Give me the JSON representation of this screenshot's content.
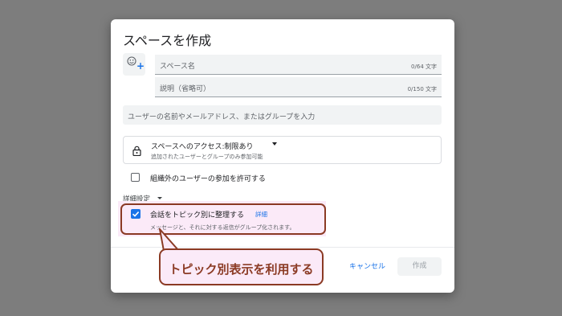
{
  "dialog": {
    "title": "スペースを作成",
    "emoji_icon": "emoji-add-icon",
    "name_field": {
      "placeholder": "スペース名",
      "counter": "0/64 文字"
    },
    "description_field": {
      "placeholder": "説明（省略可）",
      "counter": "0/150 文字"
    },
    "people_field": {
      "placeholder": "ユーザーの名前やメールアドレス、またはグループを入力"
    },
    "access": {
      "icon": "lock-icon",
      "title": "スペースへのアクセス:制限あり",
      "subtitle": "追加されたユーザーとグループのみ参加可能"
    },
    "external_checkbox": {
      "label": "組織外のユーザーの参加を許可する",
      "checked": false
    },
    "advanced": {
      "label": "詳細設定"
    },
    "topic_checkbox": {
      "label": "会話をトピック別に整理する",
      "link": "詳細",
      "subtitle": "メッセージと、それに対する返信がグループ化されます。",
      "checked": true
    },
    "cancel_label": "キャンセル",
    "create_label": "作成"
  },
  "annotation": {
    "callout_text": "トピック別表示を利用する",
    "color": "#8b3a24",
    "fill": "#fbeaf8"
  },
  "colors": {
    "backdrop": "#7d7d7d",
    "accent": "#1a73e8",
    "field_bg": "#f1f3f4"
  }
}
